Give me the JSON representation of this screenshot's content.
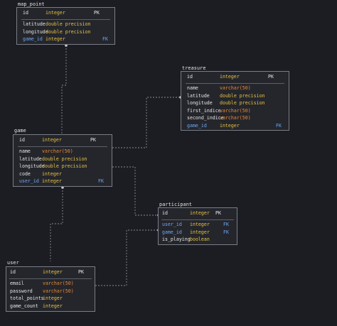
{
  "tables": {
    "map_point": {
      "title": "map_point",
      "pk": {
        "name": "id",
        "type": "integer",
        "key": "PK"
      },
      "columns": [
        {
          "name": "latitude",
          "type": "double precision",
          "key": ""
        },
        {
          "name": "longitude",
          "type": "double precision",
          "key": ""
        },
        {
          "name": "game_id",
          "type": "integer",
          "key": "FK"
        }
      ]
    },
    "treasure": {
      "title": "treasure",
      "pk": {
        "name": "id",
        "type": "integer",
        "key": "PK"
      },
      "columns": [
        {
          "name": "name",
          "type": "varchar(50)",
          "key": ""
        },
        {
          "name": "latitude",
          "type": "double precision",
          "key": ""
        },
        {
          "name": "longitude",
          "type": "double precision",
          "key": ""
        },
        {
          "name": "first_indice",
          "type": "varchar(50)",
          "key": ""
        },
        {
          "name": "second_indice",
          "type": "varchar(50)",
          "key": ""
        },
        {
          "name": "game_id",
          "type": "integer",
          "key": "FK"
        }
      ]
    },
    "game": {
      "title": "game",
      "pk": {
        "name": "id",
        "type": "integer",
        "key": "PK"
      },
      "columns": [
        {
          "name": "name",
          "type": "varchar(50)",
          "key": ""
        },
        {
          "name": "latitude",
          "type": "double precision",
          "key": ""
        },
        {
          "name": "longitude",
          "type": "double precision",
          "key": ""
        },
        {
          "name": "code",
          "type": "integer",
          "key": ""
        },
        {
          "name": "user_id",
          "type": "integer",
          "key": "FK"
        }
      ]
    },
    "participant": {
      "title": "participant",
      "pk": {
        "name": "id",
        "type": "integer",
        "key": "PK"
      },
      "columns": [
        {
          "name": "user_id",
          "type": "integer",
          "key": "FK"
        },
        {
          "name": "game_id",
          "type": "integer",
          "key": "FK"
        },
        {
          "name": "is_playing",
          "type": "boolean",
          "key": ""
        }
      ]
    },
    "user": {
      "title": "user",
      "pk": {
        "name": "id",
        "type": "integer",
        "key": "PK"
      },
      "columns": [
        {
          "name": "email",
          "type": "varchar(50)",
          "key": ""
        },
        {
          "name": "password",
          "type": "varchar(50)",
          "key": ""
        },
        {
          "name": "total_points",
          "type": "integer",
          "key": ""
        },
        {
          "name": "game_count",
          "type": "integer",
          "key": ""
        }
      ]
    }
  },
  "colors": {
    "background": "#1c1d22",
    "box": "#24262c",
    "border": "#7a7d86",
    "integer": "#e8c042",
    "varchar": "#e98a36",
    "fk": "#6ea8f5",
    "connector": "#8a8c94"
  }
}
